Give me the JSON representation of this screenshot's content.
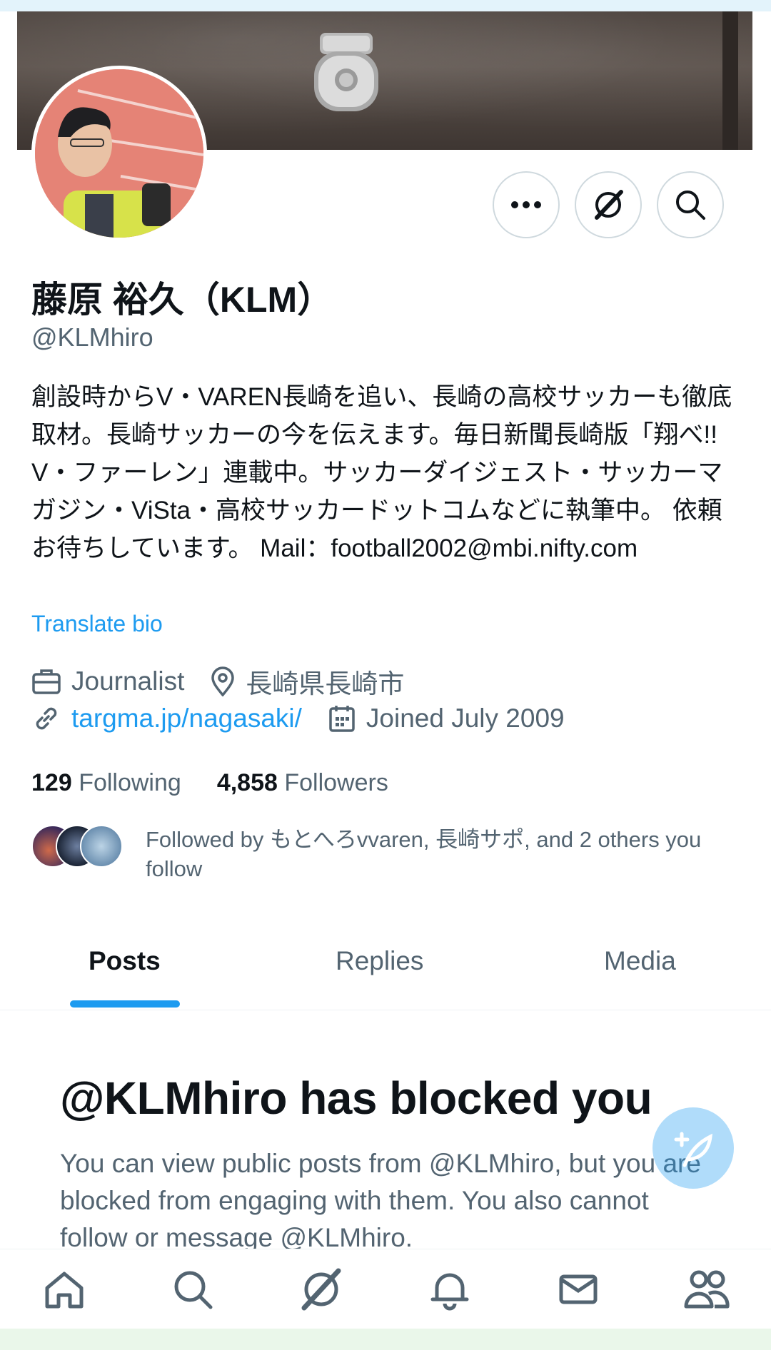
{
  "profile": {
    "name": "藤原 裕久（KLM）",
    "handle": "@KLMhiro",
    "bio": "創設時からV・VAREN長崎を追い、長崎の高校サッカーも徹底取材。長崎サッカーの今を伝えます。毎日新聞長崎版「翔べ!! V・ファーレン」連載中。サッカーダイジェスト・サッカーマガジン・ViSta・高校サッカードットコムなどに執筆中。 依頼お待ちしています。 Mail：football2002@mbi.nifty.com",
    "translate_label": "Translate bio",
    "job": "Journalist",
    "location": "長崎県長崎市",
    "website": "targma.jp/nagasaki/",
    "joined": "Joined July 2009",
    "following_count": "129",
    "following_label": "Following",
    "followers_count": "4,858",
    "followers_label": "Followers",
    "followed_by": "Followed by もとへろvvaren, 長崎サポ, and 2 others you follow"
  },
  "actions": {
    "more_icon": "more-icon",
    "grok_icon": "grok-icon",
    "search_icon": "search-icon"
  },
  "tabs": [
    {
      "label": "Posts",
      "active": true
    },
    {
      "label": "Replies",
      "active": false
    },
    {
      "label": "Media",
      "active": false
    }
  ],
  "blocked": {
    "title": "@KLMhiro has blocked you",
    "body": "You can view public posts from @KLMhiro, but you are blocked from engaging with them. You also cannot follow or message @KLMhiro."
  },
  "bottom_nav": [
    "home-icon",
    "search-icon",
    "grok-icon",
    "bell-icon",
    "mail-icon",
    "people-icon"
  ],
  "colors": {
    "accent": "#1d9bf0",
    "text_primary": "#0f1419",
    "text_secondary": "#536471",
    "border": "#cfd9de"
  }
}
